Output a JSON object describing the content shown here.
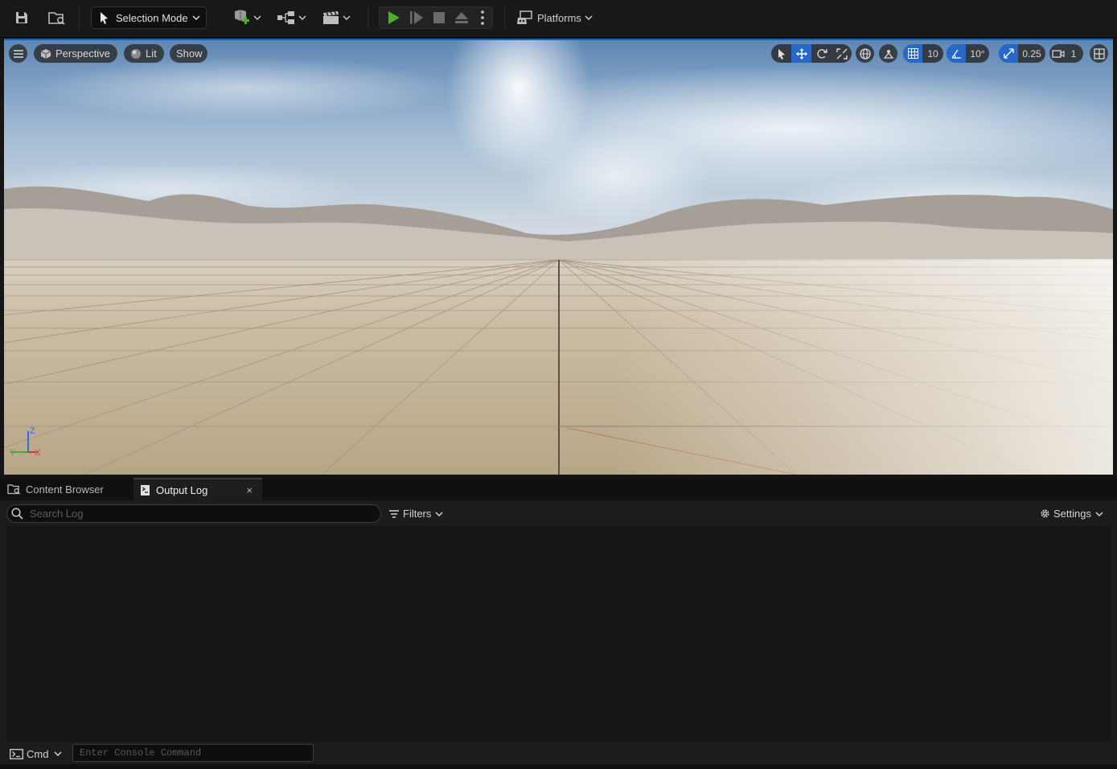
{
  "toolbar": {
    "selection_mode_label": "Selection Mode",
    "platforms_label": "Platforms",
    "icons": [
      "save-icon",
      "content-browser-icon",
      "selection-cursor-icon",
      "add-actor-icon",
      "blueprint-icon",
      "cinematics-icon",
      "play-icon",
      "advance-frame-icon",
      "stop-icon",
      "eject-icon",
      "more-options-icon",
      "platforms-icon"
    ],
    "play_color": "#4caf26"
  },
  "viewport": {
    "menu_icon": "hamburger-icon",
    "view_mode_label": "Perspective",
    "lighting_label": "Lit",
    "show_label": "Show",
    "grid_snap_value": "10",
    "rotation_snap_value": "10°",
    "scale_snap_value": "0.25",
    "camera_speed_value": "1",
    "active_accent": "#2868c8",
    "axis_labels": {
      "x": "X",
      "y": "Y",
      "z": "Z"
    },
    "sky_color": "#7fa6c9",
    "ground_color": "#c7b89e"
  },
  "bottom_panel": {
    "tabs": [
      {
        "label": "Content Browser",
        "active": false
      },
      {
        "label": "Output Log",
        "active": true
      }
    ],
    "close_label": "×",
    "search_placeholder": "Search Log",
    "filters_label": "Filters",
    "settings_label": "Settings",
    "cmd_label": "Cmd",
    "console_placeholder": "Enter Console Command"
  }
}
